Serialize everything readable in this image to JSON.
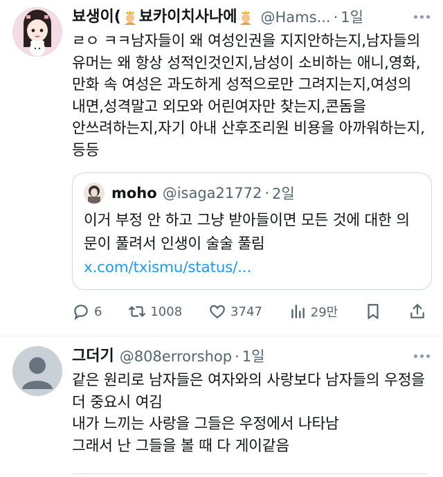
{
  "tweet1": {
    "name_part1": "뵤생이(",
    "name_part2": "뵤카이치사나에",
    "handle": "@Hams...",
    "dot": "·",
    "time": "1일",
    "text": "ㄹㅇ ㅋㅋ남자들이 왜 여성인권을 지지안하는지,남자들의 유머는 왜 항상 성적인것인지,남성이 소비하는 애니,영화,만화 속 여성은 과도하게 성적으로만 그려지는지,여성의 내면,성격말고 외모와 어린여자만 찾는지,콘돔을 안쓰려하는지,자기 아내 산후조리원 비용을 아까워하는지, 등등",
    "quote": {
      "name": "moho",
      "handle": "@isaga21772",
      "dot": "·",
      "time": "2일",
      "text": "이거 부정 안 하고 그냥 받아들이면 모든 것에 대한 의문이 풀려서 인생이 술술 풀림 ",
      "link": "x.com/txismu/status/..."
    },
    "actions": {
      "replies": "6",
      "retweets": "1008",
      "likes": "3747",
      "views": "29만"
    }
  },
  "tweet2": {
    "name": "그더기",
    "handle": "@808errorshop",
    "dot": "·",
    "time": "1일",
    "text": "같은 원리로 남자들은 여자와의 사랑보다 남자들의 우정을 더 중요시 여김\n내가 느끼는 사랑을 그들은 우정에서 나타남\n그래서 난 그들을 볼 때 다 게이같음"
  },
  "colors": {
    "text": "#0f1419",
    "secondary": "#536471",
    "link": "#1d9bf0",
    "border": "#cfd9de"
  }
}
